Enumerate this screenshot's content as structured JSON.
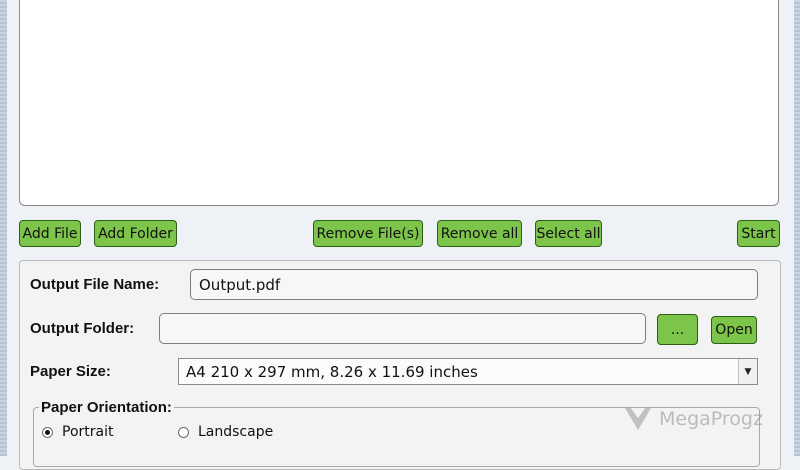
{
  "toolbar": {
    "add_file": "Add File",
    "add_folder": "Add Folder",
    "remove_files": "Remove File(s)",
    "remove_all": "Remove all",
    "select_all": "Select all",
    "start": "Start"
  },
  "output": {
    "file_name_label": "Output File Name:",
    "file_name_value": "Output.pdf",
    "folder_label": "Output Folder:",
    "folder_value": "",
    "browse_label": "...",
    "open_label": "Open"
  },
  "paper": {
    "size_label": "Paper Size:",
    "size_selected": "A4 210 x 297 mm, 8.26 x 11.69 inches",
    "orientation_label": "Paper Orientation:",
    "orientation_options": [
      "Portrait",
      "Landscape"
    ],
    "orientation_selected": "Portrait"
  },
  "watermark": {
    "text": "MegaProgz"
  },
  "colors": {
    "button_green": "#7cc44a",
    "button_border": "#2e5e16"
  }
}
